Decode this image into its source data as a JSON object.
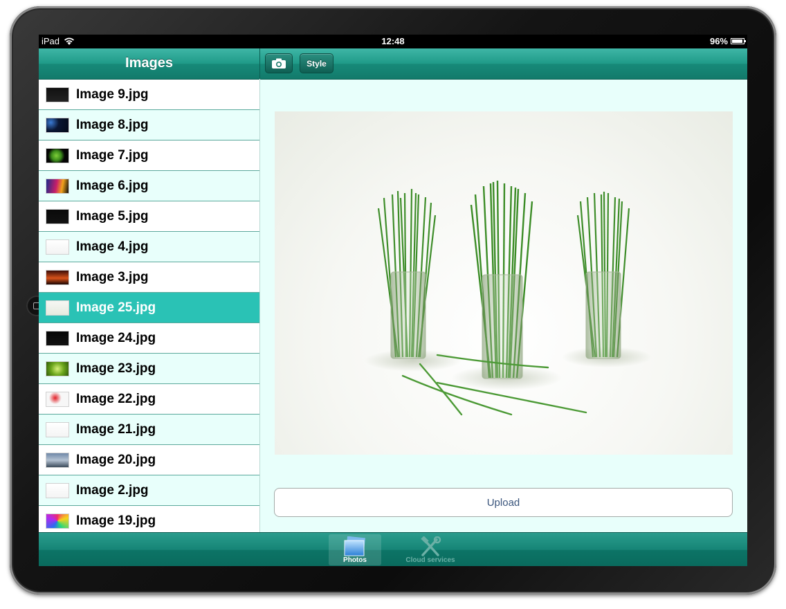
{
  "status_bar": {
    "device": "iPad",
    "time": "12:48",
    "battery": "96%"
  },
  "master": {
    "title": "Images"
  },
  "toolbar": {
    "camera_icon": "camera-icon",
    "style_label": "Style"
  },
  "images": [
    {
      "label": "Image 9.jpg",
      "selected": false
    },
    {
      "label": "Image 8.jpg",
      "selected": false
    },
    {
      "label": "Image 7.jpg",
      "selected": false
    },
    {
      "label": "Image 6.jpg",
      "selected": false
    },
    {
      "label": "Image 5.jpg",
      "selected": false
    },
    {
      "label": "Image 4.jpg",
      "selected": false
    },
    {
      "label": "Image 3.jpg",
      "selected": false
    },
    {
      "label": "Image 25.jpg",
      "selected": true
    },
    {
      "label": "Image 24.jpg",
      "selected": false
    },
    {
      "label": "Image 23.jpg",
      "selected": false
    },
    {
      "label": "Image 22.jpg",
      "selected": false
    },
    {
      "label": "Image 21.jpg",
      "selected": false
    },
    {
      "label": "Image 20.jpg",
      "selected": false
    },
    {
      "label": "Image 2.jpg",
      "selected": false
    },
    {
      "label": "Image 19.jpg",
      "selected": false
    }
  ],
  "detail": {
    "upload_label": "Upload"
  },
  "tabs": [
    {
      "label": "Photos",
      "icon": "photos-icon",
      "active": true
    },
    {
      "label": "Cloud services",
      "icon": "tools-icon",
      "active": false
    }
  ],
  "colors": {
    "accent": "#1f9a88",
    "selected_row": "#2ac2b5",
    "background": "#e8fffb"
  }
}
